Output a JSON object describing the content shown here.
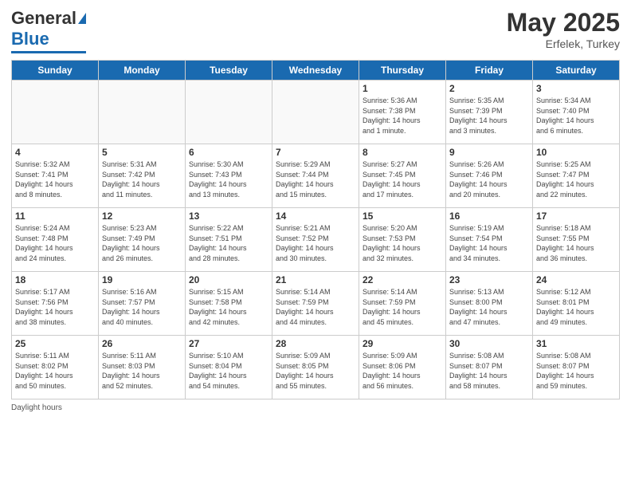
{
  "header": {
    "logo_general": "General",
    "logo_blue": "Blue",
    "title": "May 2025",
    "location": "Erfelek, Turkey"
  },
  "days_of_week": [
    "Sunday",
    "Monday",
    "Tuesday",
    "Wednesday",
    "Thursday",
    "Friday",
    "Saturday"
  ],
  "footer_text": "Daylight hours",
  "weeks": [
    [
      {
        "day": "",
        "info": ""
      },
      {
        "day": "",
        "info": ""
      },
      {
        "day": "",
        "info": ""
      },
      {
        "day": "",
        "info": ""
      },
      {
        "day": "1",
        "info": "Sunrise: 5:36 AM\nSunset: 7:38 PM\nDaylight: 14 hours\nand 1 minute."
      },
      {
        "day": "2",
        "info": "Sunrise: 5:35 AM\nSunset: 7:39 PM\nDaylight: 14 hours\nand 3 minutes."
      },
      {
        "day": "3",
        "info": "Sunrise: 5:34 AM\nSunset: 7:40 PM\nDaylight: 14 hours\nand 6 minutes."
      }
    ],
    [
      {
        "day": "4",
        "info": "Sunrise: 5:32 AM\nSunset: 7:41 PM\nDaylight: 14 hours\nand 8 minutes."
      },
      {
        "day": "5",
        "info": "Sunrise: 5:31 AM\nSunset: 7:42 PM\nDaylight: 14 hours\nand 11 minutes."
      },
      {
        "day": "6",
        "info": "Sunrise: 5:30 AM\nSunset: 7:43 PM\nDaylight: 14 hours\nand 13 minutes."
      },
      {
        "day": "7",
        "info": "Sunrise: 5:29 AM\nSunset: 7:44 PM\nDaylight: 14 hours\nand 15 minutes."
      },
      {
        "day": "8",
        "info": "Sunrise: 5:27 AM\nSunset: 7:45 PM\nDaylight: 14 hours\nand 17 minutes."
      },
      {
        "day": "9",
        "info": "Sunrise: 5:26 AM\nSunset: 7:46 PM\nDaylight: 14 hours\nand 20 minutes."
      },
      {
        "day": "10",
        "info": "Sunrise: 5:25 AM\nSunset: 7:47 PM\nDaylight: 14 hours\nand 22 minutes."
      }
    ],
    [
      {
        "day": "11",
        "info": "Sunrise: 5:24 AM\nSunset: 7:48 PM\nDaylight: 14 hours\nand 24 minutes."
      },
      {
        "day": "12",
        "info": "Sunrise: 5:23 AM\nSunset: 7:49 PM\nDaylight: 14 hours\nand 26 minutes."
      },
      {
        "day": "13",
        "info": "Sunrise: 5:22 AM\nSunset: 7:51 PM\nDaylight: 14 hours\nand 28 minutes."
      },
      {
        "day": "14",
        "info": "Sunrise: 5:21 AM\nSunset: 7:52 PM\nDaylight: 14 hours\nand 30 minutes."
      },
      {
        "day": "15",
        "info": "Sunrise: 5:20 AM\nSunset: 7:53 PM\nDaylight: 14 hours\nand 32 minutes."
      },
      {
        "day": "16",
        "info": "Sunrise: 5:19 AM\nSunset: 7:54 PM\nDaylight: 14 hours\nand 34 minutes."
      },
      {
        "day": "17",
        "info": "Sunrise: 5:18 AM\nSunset: 7:55 PM\nDaylight: 14 hours\nand 36 minutes."
      }
    ],
    [
      {
        "day": "18",
        "info": "Sunrise: 5:17 AM\nSunset: 7:56 PM\nDaylight: 14 hours\nand 38 minutes."
      },
      {
        "day": "19",
        "info": "Sunrise: 5:16 AM\nSunset: 7:57 PM\nDaylight: 14 hours\nand 40 minutes."
      },
      {
        "day": "20",
        "info": "Sunrise: 5:15 AM\nSunset: 7:58 PM\nDaylight: 14 hours\nand 42 minutes."
      },
      {
        "day": "21",
        "info": "Sunrise: 5:14 AM\nSunset: 7:59 PM\nDaylight: 14 hours\nand 44 minutes."
      },
      {
        "day": "22",
        "info": "Sunrise: 5:14 AM\nSunset: 7:59 PM\nDaylight: 14 hours\nand 45 minutes."
      },
      {
        "day": "23",
        "info": "Sunrise: 5:13 AM\nSunset: 8:00 PM\nDaylight: 14 hours\nand 47 minutes."
      },
      {
        "day": "24",
        "info": "Sunrise: 5:12 AM\nSunset: 8:01 PM\nDaylight: 14 hours\nand 49 minutes."
      }
    ],
    [
      {
        "day": "25",
        "info": "Sunrise: 5:11 AM\nSunset: 8:02 PM\nDaylight: 14 hours\nand 50 minutes."
      },
      {
        "day": "26",
        "info": "Sunrise: 5:11 AM\nSunset: 8:03 PM\nDaylight: 14 hours\nand 52 minutes."
      },
      {
        "day": "27",
        "info": "Sunrise: 5:10 AM\nSunset: 8:04 PM\nDaylight: 14 hours\nand 54 minutes."
      },
      {
        "day": "28",
        "info": "Sunrise: 5:09 AM\nSunset: 8:05 PM\nDaylight: 14 hours\nand 55 minutes."
      },
      {
        "day": "29",
        "info": "Sunrise: 5:09 AM\nSunset: 8:06 PM\nDaylight: 14 hours\nand 56 minutes."
      },
      {
        "day": "30",
        "info": "Sunrise: 5:08 AM\nSunset: 8:07 PM\nDaylight: 14 hours\nand 58 minutes."
      },
      {
        "day": "31",
        "info": "Sunrise: 5:08 AM\nSunset: 8:07 PM\nDaylight: 14 hours\nand 59 minutes."
      }
    ]
  ]
}
